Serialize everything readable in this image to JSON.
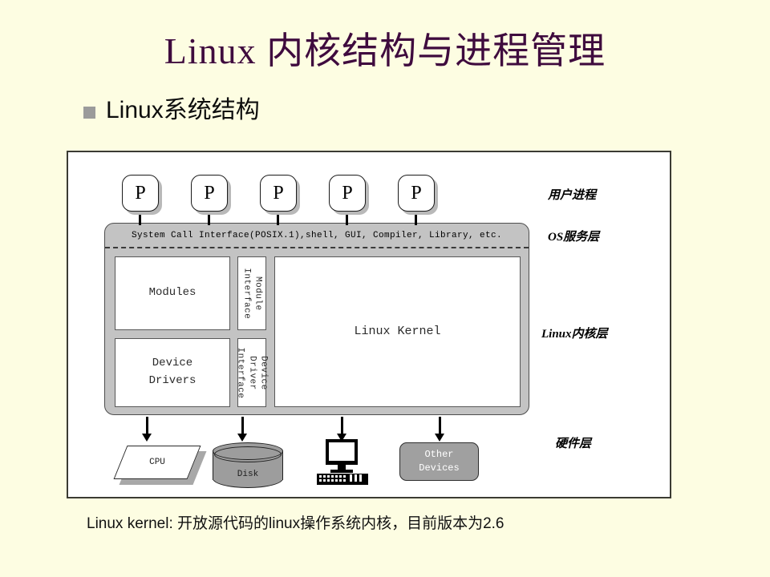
{
  "slide": {
    "title": "Linux 内核结构与进程管理",
    "bullet": {
      "marker": "square-bullet",
      "text": "Linux系统结构"
    },
    "caption": "Linux kernel: 开放源代码的linux操作系统内核，目前版本为2.6"
  },
  "colors": {
    "background": "#fdfde2",
    "title": "#3f0b3e",
    "bullet_marker": "#9b9b9b",
    "panel_gray": "#c3c3c3",
    "device_gray": "#a0a0a0",
    "frame_border": "#3b3b33"
  },
  "diagram": {
    "processes": [
      {
        "label": "P"
      },
      {
        "label": "P"
      },
      {
        "label": "P"
      },
      {
        "label": "P"
      },
      {
        "label": "P"
      }
    ],
    "syscall_bar": "System Call Interface(POSIX.1),shell, GUI, Compiler, Library, etc.",
    "kernel_boxes": {
      "modules": "Modules",
      "device_drivers": "Device\nDrivers",
      "module_interface": "Module\nInterface",
      "device_driver_interface": "Device\nDriver\nInterface",
      "linux_kernel": "Linux Kernel"
    },
    "hardware": {
      "cpu": "CPU",
      "disk": "Disk",
      "computer": "computer-icon",
      "other_devices": "Other\nDevices"
    },
    "layer_labels": [
      "用户进程",
      "OS服务层",
      "Linux内核层",
      "硬件层"
    ]
  }
}
